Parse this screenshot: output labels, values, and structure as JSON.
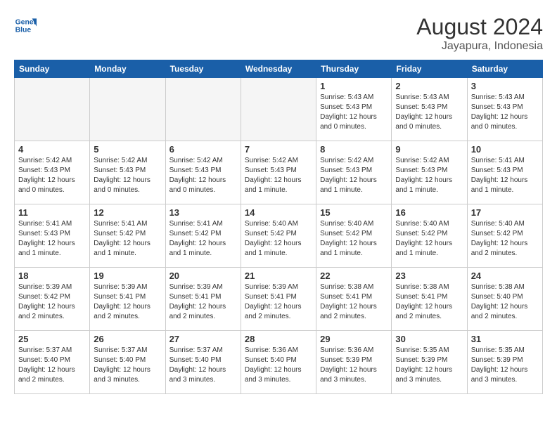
{
  "header": {
    "logo_line1": "General",
    "logo_line2": "Blue",
    "month_year": "August 2024",
    "location": "Jayapura, Indonesia"
  },
  "weekdays": [
    "Sunday",
    "Monday",
    "Tuesday",
    "Wednesday",
    "Thursday",
    "Friday",
    "Saturday"
  ],
  "weeks": [
    [
      {
        "day": "",
        "info": ""
      },
      {
        "day": "",
        "info": ""
      },
      {
        "day": "",
        "info": ""
      },
      {
        "day": "",
        "info": ""
      },
      {
        "day": "1",
        "info": "Sunrise: 5:43 AM\nSunset: 5:43 PM\nDaylight: 12 hours\nand 0 minutes."
      },
      {
        "day": "2",
        "info": "Sunrise: 5:43 AM\nSunset: 5:43 PM\nDaylight: 12 hours\nand 0 minutes."
      },
      {
        "day": "3",
        "info": "Sunrise: 5:43 AM\nSunset: 5:43 PM\nDaylight: 12 hours\nand 0 minutes."
      }
    ],
    [
      {
        "day": "4",
        "info": "Sunrise: 5:42 AM\nSunset: 5:43 PM\nDaylight: 12 hours\nand 0 minutes."
      },
      {
        "day": "5",
        "info": "Sunrise: 5:42 AM\nSunset: 5:43 PM\nDaylight: 12 hours\nand 0 minutes."
      },
      {
        "day": "6",
        "info": "Sunrise: 5:42 AM\nSunset: 5:43 PM\nDaylight: 12 hours\nand 0 minutes."
      },
      {
        "day": "7",
        "info": "Sunrise: 5:42 AM\nSunset: 5:43 PM\nDaylight: 12 hours\nand 1 minute."
      },
      {
        "day": "8",
        "info": "Sunrise: 5:42 AM\nSunset: 5:43 PM\nDaylight: 12 hours\nand 1 minute."
      },
      {
        "day": "9",
        "info": "Sunrise: 5:42 AM\nSunset: 5:43 PM\nDaylight: 12 hours\nand 1 minute."
      },
      {
        "day": "10",
        "info": "Sunrise: 5:41 AM\nSunset: 5:43 PM\nDaylight: 12 hours\nand 1 minute."
      }
    ],
    [
      {
        "day": "11",
        "info": "Sunrise: 5:41 AM\nSunset: 5:43 PM\nDaylight: 12 hours\nand 1 minute."
      },
      {
        "day": "12",
        "info": "Sunrise: 5:41 AM\nSunset: 5:42 PM\nDaylight: 12 hours\nand 1 minute."
      },
      {
        "day": "13",
        "info": "Sunrise: 5:41 AM\nSunset: 5:42 PM\nDaylight: 12 hours\nand 1 minute."
      },
      {
        "day": "14",
        "info": "Sunrise: 5:40 AM\nSunset: 5:42 PM\nDaylight: 12 hours\nand 1 minute."
      },
      {
        "day": "15",
        "info": "Sunrise: 5:40 AM\nSunset: 5:42 PM\nDaylight: 12 hours\nand 1 minute."
      },
      {
        "day": "16",
        "info": "Sunrise: 5:40 AM\nSunset: 5:42 PM\nDaylight: 12 hours\nand 1 minute."
      },
      {
        "day": "17",
        "info": "Sunrise: 5:40 AM\nSunset: 5:42 PM\nDaylight: 12 hours\nand 2 minutes."
      }
    ],
    [
      {
        "day": "18",
        "info": "Sunrise: 5:39 AM\nSunset: 5:42 PM\nDaylight: 12 hours\nand 2 minutes."
      },
      {
        "day": "19",
        "info": "Sunrise: 5:39 AM\nSunset: 5:41 PM\nDaylight: 12 hours\nand 2 minutes."
      },
      {
        "day": "20",
        "info": "Sunrise: 5:39 AM\nSunset: 5:41 PM\nDaylight: 12 hours\nand 2 minutes."
      },
      {
        "day": "21",
        "info": "Sunrise: 5:39 AM\nSunset: 5:41 PM\nDaylight: 12 hours\nand 2 minutes."
      },
      {
        "day": "22",
        "info": "Sunrise: 5:38 AM\nSunset: 5:41 PM\nDaylight: 12 hours\nand 2 minutes."
      },
      {
        "day": "23",
        "info": "Sunrise: 5:38 AM\nSunset: 5:41 PM\nDaylight: 12 hours\nand 2 minutes."
      },
      {
        "day": "24",
        "info": "Sunrise: 5:38 AM\nSunset: 5:40 PM\nDaylight: 12 hours\nand 2 minutes."
      }
    ],
    [
      {
        "day": "25",
        "info": "Sunrise: 5:37 AM\nSunset: 5:40 PM\nDaylight: 12 hours\nand 2 minutes."
      },
      {
        "day": "26",
        "info": "Sunrise: 5:37 AM\nSunset: 5:40 PM\nDaylight: 12 hours\nand 3 minutes."
      },
      {
        "day": "27",
        "info": "Sunrise: 5:37 AM\nSunset: 5:40 PM\nDaylight: 12 hours\nand 3 minutes."
      },
      {
        "day": "28",
        "info": "Sunrise: 5:36 AM\nSunset: 5:40 PM\nDaylight: 12 hours\nand 3 minutes."
      },
      {
        "day": "29",
        "info": "Sunrise: 5:36 AM\nSunset: 5:39 PM\nDaylight: 12 hours\nand 3 minutes."
      },
      {
        "day": "30",
        "info": "Sunrise: 5:35 AM\nSunset: 5:39 PM\nDaylight: 12 hours\nand 3 minutes."
      },
      {
        "day": "31",
        "info": "Sunrise: 5:35 AM\nSunset: 5:39 PM\nDaylight: 12 hours\nand 3 minutes."
      }
    ]
  ]
}
